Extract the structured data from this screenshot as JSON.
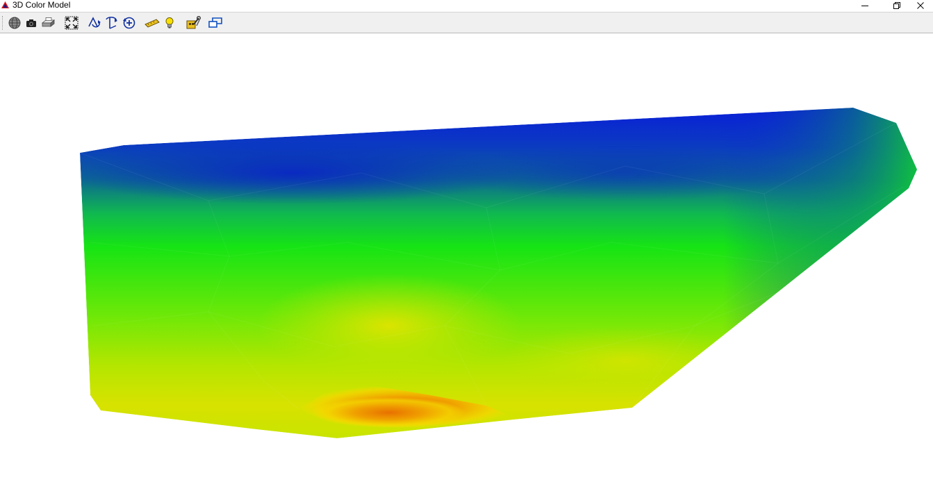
{
  "window": {
    "title": "3D Color Model",
    "controls": [
      "minimize",
      "restore",
      "close"
    ]
  },
  "toolbar": {
    "buttons": [
      {
        "name": "globe-icon",
        "tooltip": ""
      },
      {
        "name": "camera-icon",
        "tooltip": ""
      },
      {
        "name": "printer-icon",
        "tooltip": ""
      },
      {
        "name": "zoom-extents-icon",
        "tooltip": ""
      },
      {
        "name": "rotate-x-icon",
        "tooltip": ""
      },
      {
        "name": "rotate-y-icon",
        "tooltip": ""
      },
      {
        "name": "rotate-z-icon",
        "tooltip": ""
      },
      {
        "name": "ruler-icon",
        "tooltip": ""
      },
      {
        "name": "light-bulb-icon",
        "tooltip": ""
      },
      {
        "name": "settings-tools-icon",
        "tooltip": ""
      },
      {
        "name": "window-restore-icon",
        "tooltip": ""
      }
    ]
  },
  "model": {
    "color_scale": [
      "#0a1fd8",
      "#0c5aa0",
      "#0a8a70",
      "#14e010",
      "#a8e600",
      "#e8e000",
      "#f0a800",
      "#e87800"
    ],
    "accent_low": "#0a1fd8",
    "accent_mid": "#14e010",
    "accent_high": "#e87800"
  }
}
